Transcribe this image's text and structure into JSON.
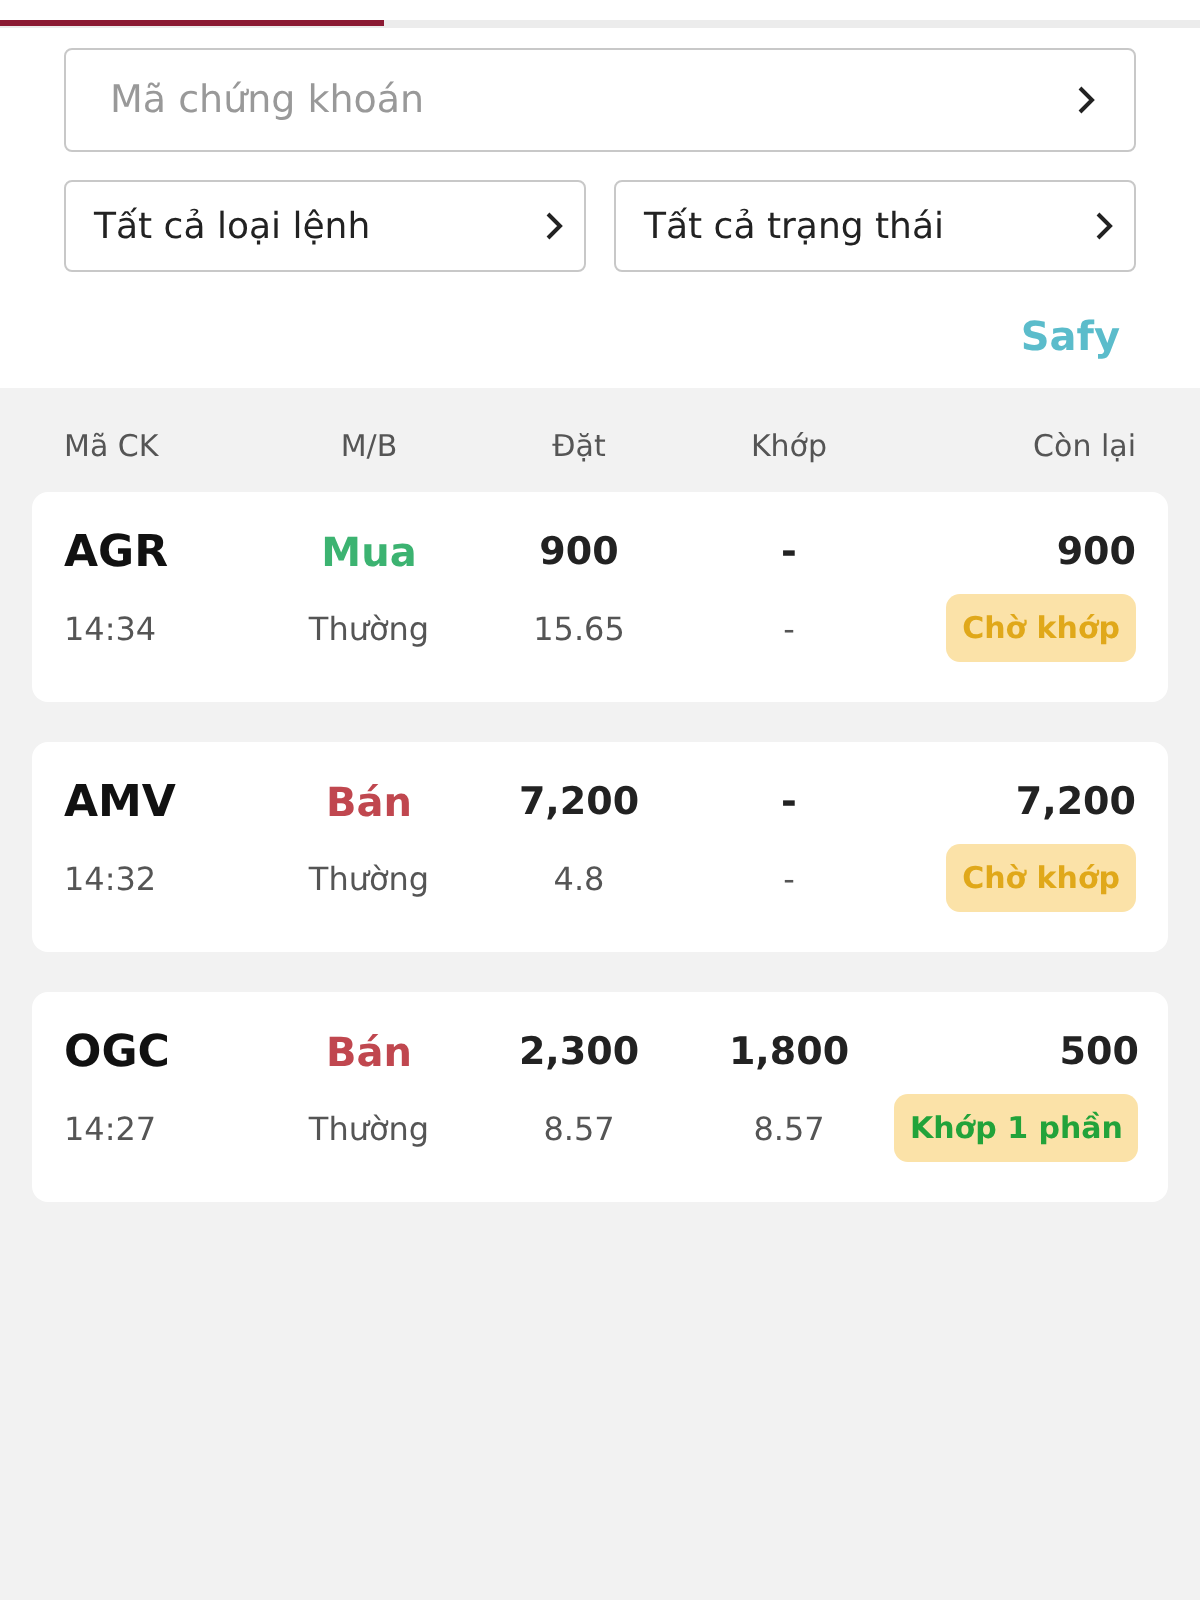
{
  "tab_indicator": {
    "level": 0.32
  },
  "filters": {
    "symbol": {
      "placeholder": "Mã chứng khoán"
    },
    "order_type": {
      "value": "Tất cả loại lệnh"
    },
    "status": {
      "value": "Tất cả trạng thái"
    }
  },
  "brand": {
    "text": "Safy"
  },
  "table": {
    "columns": [
      "Mã CK",
      "M/B",
      "Đặt",
      "Khớp",
      "Còn lại"
    ],
    "rows": [
      {
        "symbol": "AGR",
        "time": "14:34",
        "side": {
          "kind": "buy",
          "label": "Mua"
        },
        "order_class": "Thường",
        "qty": "900",
        "price": "15.65",
        "matched_qty": "-",
        "matched_price": "-",
        "remaining": "900",
        "status": {
          "kind": "pending",
          "label": "Chờ khớp"
        }
      },
      {
        "symbol": "AMV",
        "time": "14:32",
        "side": {
          "kind": "sell",
          "label": "Bán"
        },
        "order_class": "Thường",
        "qty": "7,200",
        "price": "4.8",
        "matched_qty": "-",
        "matched_price": "-",
        "remaining": "7,200",
        "status": {
          "kind": "pending",
          "label": "Chờ khớp"
        }
      },
      {
        "symbol": "OGC",
        "time": "14:27",
        "side": {
          "kind": "sell",
          "label": "Bán"
        },
        "order_class": "Thường",
        "qty": "2,300",
        "price": "8.57",
        "matched_qty": "1,800",
        "matched_price": "8.57",
        "remaining": "500",
        "status": {
          "kind": "partial",
          "label": "Khớp 1 phần"
        }
      }
    ]
  }
}
